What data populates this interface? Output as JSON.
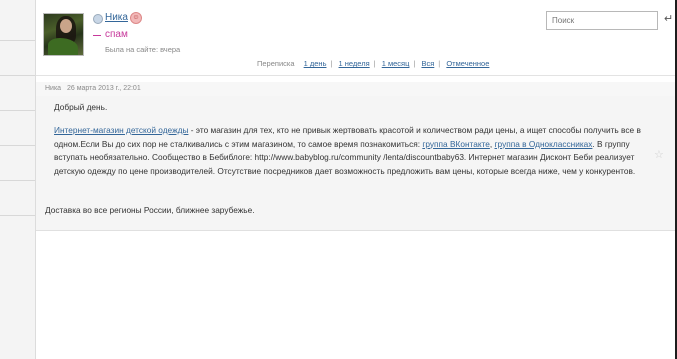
{
  "profile": {
    "name": "Ника",
    "status_tag": "спам",
    "last_seen": "Была на сайте: вчера"
  },
  "search": {
    "placeholder": "Поиск"
  },
  "icons": {
    "return": "return-arrow-icon",
    "star": "star-icon"
  },
  "filters": {
    "label": "Переписка",
    "items": [
      "1 день",
      "1 неделя",
      "1 месяц",
      "Вся",
      "Отмеченное"
    ]
  },
  "message": {
    "author": "Ника",
    "date": "26 марта 2013 г., 22:01",
    "greeting": "Добрый день.",
    "link_shop": "Интернет-магазин детской одежды",
    "text_1": " - это магазин для тех, кто не привык жертвовать красотой и количеством ради цены, а ищет способы получить все в одном.Если Вы до сих пор не сталкивались с этим магазином, то самое время познакомиться: ",
    "link_vk": "группа ВКонтакте",
    "text_2": ", ",
    "link_ok": "группа в Одноклассниках",
    "text_3": ". В группу вступать необязательно. Сообщество в Бебиблоге: http://www.babyblog.ru/community /lenta/discountbaby63. Интернет магазин Дисконт Беби реализует детскую одежду по цене производителей. Отсутствие посредников дает возможность предложить вам цены, которые всегда ниже, чем у конкурентов.",
    "delivery": "Доставка во все регионы России, ближнее зарубежье."
  },
  "colors": {
    "link": "#336699",
    "spam": "#c7399b",
    "message_bg": "#f5f5f5"
  }
}
